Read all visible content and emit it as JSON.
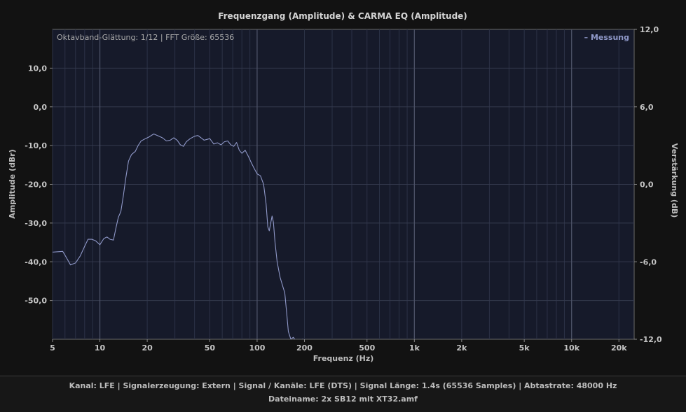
{
  "chart_data": {
    "type": "line",
    "title": "Frequenzgang (Amplitude) & CARMA EQ (Amplitude)",
    "xlabel": "Frequenz (Hz)",
    "ylabel": "Amplitude (dBr)",
    "y2label": "Verstärkung (dB)",
    "xscale": "log",
    "xlim": [
      5,
      25000
    ],
    "ylim": [
      -60,
      20
    ],
    "y2lim": [
      -12,
      12
    ],
    "xticks": [
      {
        "v": 5,
        "label": "5"
      },
      {
        "v": 10,
        "label": "10"
      },
      {
        "v": 20,
        "label": "20"
      },
      {
        "v": 50,
        "label": "50"
      },
      {
        "v": 100,
        "label": "100"
      },
      {
        "v": 200,
        "label": "200"
      },
      {
        "v": 500,
        "label": "500"
      },
      {
        "v": 1000,
        "label": "1k"
      },
      {
        "v": 2000,
        "label": "2k"
      },
      {
        "v": 5000,
        "label": "5k"
      },
      {
        "v": 10000,
        "label": "10k"
      },
      {
        "v": 20000,
        "label": "20k"
      }
    ],
    "yticks": [
      {
        "v": 10,
        "label": "10,0"
      },
      {
        "v": 0,
        "label": "0,0"
      },
      {
        "v": -10,
        "label": "-10,0"
      },
      {
        "v": -20,
        "label": "-20,0"
      },
      {
        "v": -30,
        "label": "-30,0"
      },
      {
        "v": -40,
        "label": "-40,0"
      },
      {
        "v": -50,
        "label": "-50,0"
      }
    ],
    "y2ticks": [
      {
        "v": 12,
        "label": "12,0"
      },
      {
        "v": 6,
        "label": "6,0"
      },
      {
        "v": 0,
        "label": "0,0"
      },
      {
        "v": -6,
        "label": "-6,0"
      },
      {
        "v": -12,
        "label": "-12,0"
      }
    ],
    "info_text": "Oktavband-Glättung: 1/12 | FFT Größe: 65536",
    "legend_position": "top-right",
    "grid": true,
    "series": [
      {
        "name": "Messung",
        "color": "#8f98c8",
        "points": [
          [
            5,
            -37.5
          ],
          [
            5.8,
            -37.3
          ],
          [
            6.1,
            -38.8
          ],
          [
            6.5,
            -40.8
          ],
          [
            7.0,
            -40.3
          ],
          [
            7.5,
            -38.5
          ],
          [
            8.0,
            -36.0
          ],
          [
            8.4,
            -34.2
          ],
          [
            8.9,
            -34.2
          ],
          [
            9.4,
            -34.6
          ],
          [
            10.0,
            -35.6
          ],
          [
            10.6,
            -34.0
          ],
          [
            11.1,
            -33.6
          ],
          [
            11.6,
            -34.2
          ],
          [
            12.2,
            -34.4
          ],
          [
            12.7,
            -31.0
          ],
          [
            13.1,
            -28.5
          ],
          [
            13.6,
            -27.0
          ],
          [
            14.1,
            -23.0
          ],
          [
            14.6,
            -18.5
          ],
          [
            15.2,
            -14.0
          ],
          [
            15.9,
            -12.3
          ],
          [
            16.8,
            -11.5
          ],
          [
            17.5,
            -10.0
          ],
          [
            18.3,
            -8.8
          ],
          [
            19.5,
            -8.2
          ],
          [
            20.5,
            -7.8
          ],
          [
            22.0,
            -7.0
          ],
          [
            23.5,
            -7.5
          ],
          [
            25.0,
            -8.0
          ],
          [
            26.5,
            -8.8
          ],
          [
            28.0,
            -8.6
          ],
          [
            29.5,
            -8.0
          ],
          [
            31.0,
            -8.6
          ],
          [
            32.5,
            -9.8
          ],
          [
            34.0,
            -10.2
          ],
          [
            35.5,
            -9.0
          ],
          [
            37.5,
            -8.2
          ],
          [
            40.0,
            -7.6
          ],
          [
            42.0,
            -7.4
          ],
          [
            44.0,
            -8.0
          ],
          [
            46.0,
            -8.6
          ],
          [
            48.0,
            -8.4
          ],
          [
            50.0,
            -8.2
          ],
          [
            53.0,
            -9.6
          ],
          [
            56.0,
            -9.3
          ],
          [
            59.0,
            -9.8
          ],
          [
            62.0,
            -9.0
          ],
          [
            65.0,
            -8.8
          ],
          [
            68.0,
            -9.8
          ],
          [
            71.0,
            -10.2
          ],
          [
            74.0,
            -9.2
          ],
          [
            77.0,
            -11.2
          ],
          [
            80.0,
            -12.0
          ],
          [
            84.0,
            -11.2
          ],
          [
            88.0,
            -12.8
          ],
          [
            92.0,
            -14.5
          ],
          [
            96.0,
            -16.0
          ],
          [
            100.0,
            -17.3
          ],
          [
            105.0,
            -17.8
          ],
          [
            110.0,
            -20.0
          ],
          [
            114.0,
            -25.0
          ],
          [
            117.0,
            -31.0
          ],
          [
            119.5,
            -32.0
          ],
          [
            122.0,
            -30.0
          ],
          [
            124.5,
            -28.2
          ],
          [
            127.0,
            -29.8
          ],
          [
            130.0,
            -35.0
          ],
          [
            134.0,
            -40.0
          ],
          [
            140.0,
            -44.0
          ],
          [
            146.0,
            -46.5
          ],
          [
            150.0,
            -48.0
          ],
          [
            154.0,
            -53.0
          ],
          [
            158.0,
            -58.0
          ],
          [
            164.0,
            -60.0
          ],
          [
            170.0,
            -59.5
          ],
          [
            180.0,
            -61.0
          ],
          [
            195.0,
            -60.0
          ],
          [
            205.0,
            -61.0
          ]
        ]
      }
    ]
  },
  "footer": {
    "line1": "Kanal: LFE  |  Signalerzeugung: Extern   |  Signal / Kanäle: LFE (DTS)  |  Signal Länge: 1.4s (65536 Samples)  |  Abtastrate: 48000 Hz",
    "line2": "Dateiname: 2x SB12 mit XT32.amf"
  }
}
